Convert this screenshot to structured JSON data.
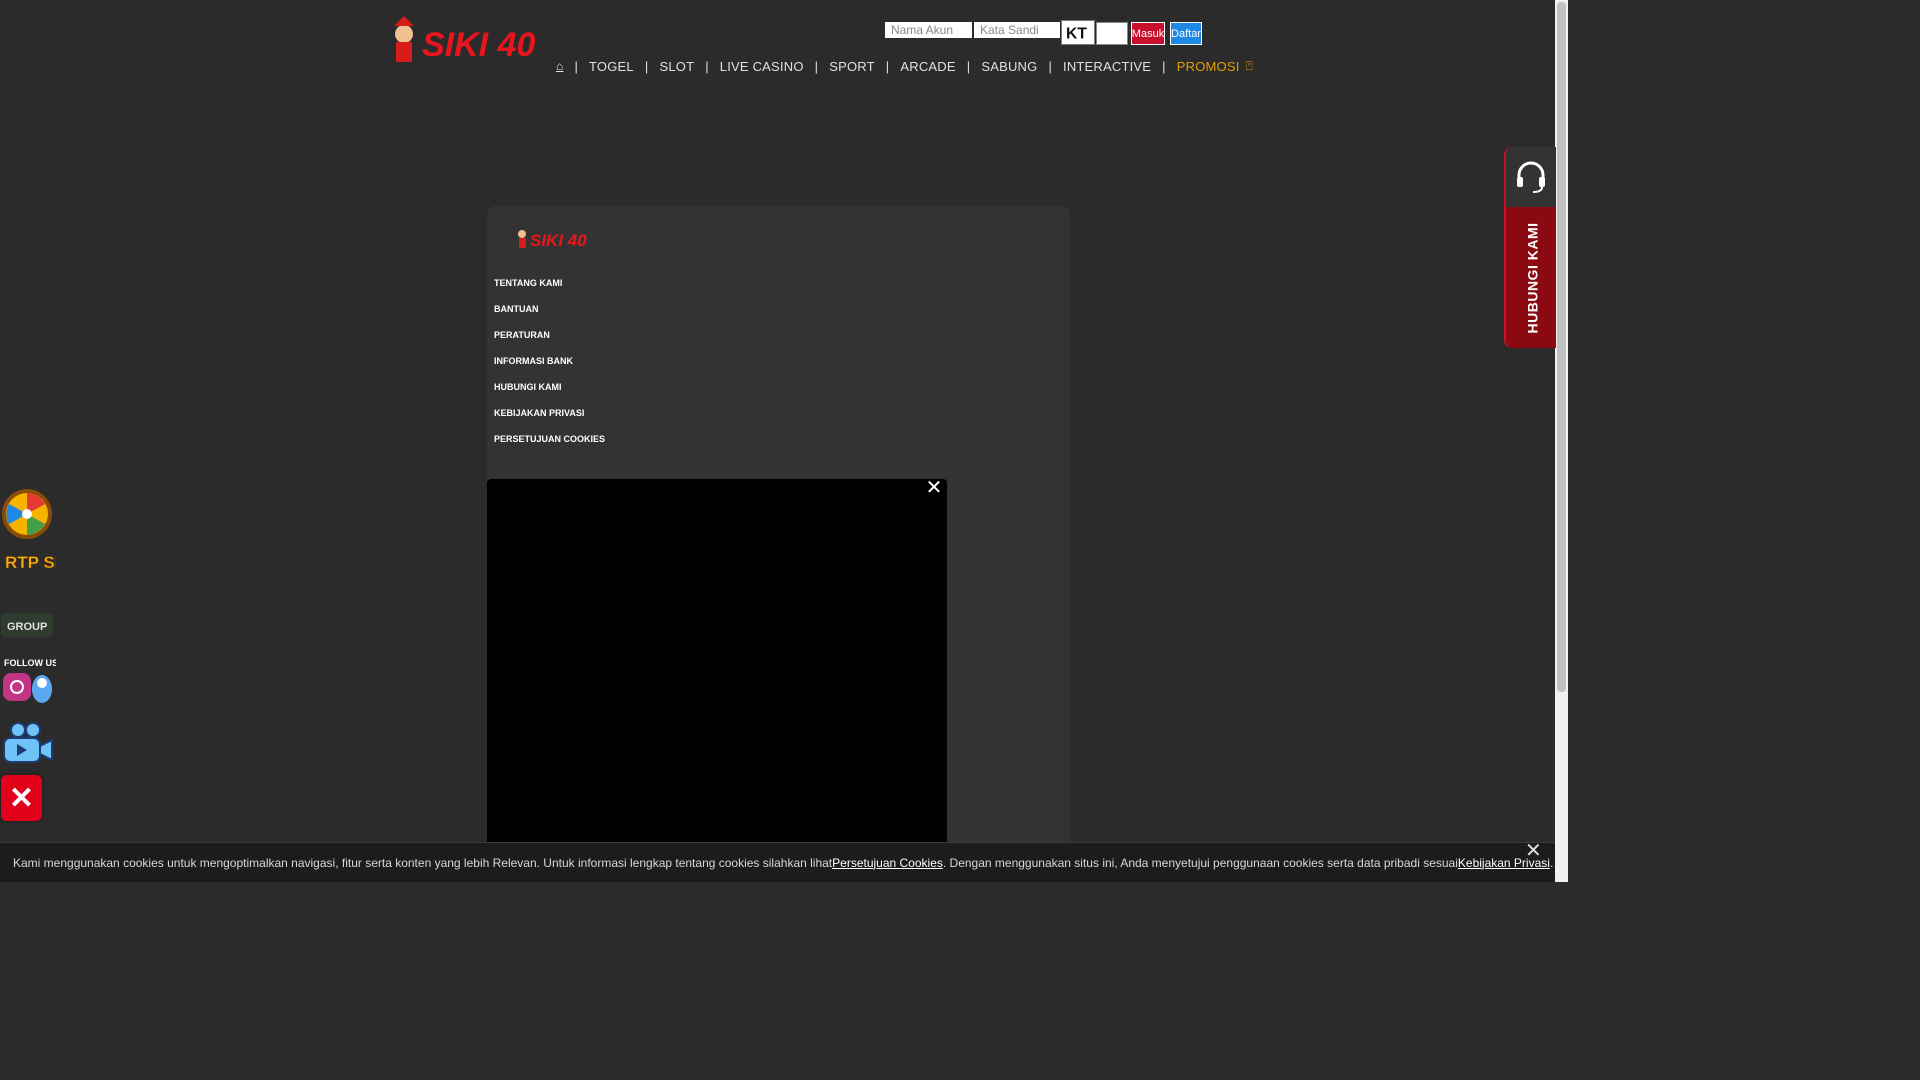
{
  "header": {
    "logo_alt": "SIKI 40",
    "login": {
      "username_placeholder": "Nama Akun",
      "password_placeholder": "Kata Sandi",
      "captcha_text": "KT",
      "login_label": "Masuk",
      "register_label": "Daftar"
    },
    "nav": [
      {
        "label": "TOGEL"
      },
      {
        "label": "SLOT"
      },
      {
        "label": "LIVE CASINO"
      },
      {
        "label": "SPORT"
      },
      {
        "label": "ARCADE"
      },
      {
        "label": "SABUNG"
      },
      {
        "label": "INTERACTIVE"
      },
      {
        "label": "PROMOSI"
      }
    ],
    "home_icon": "home-icon"
  },
  "footer": {
    "logo_alt": "SIKI 40",
    "links": [
      "TENTANG KAMI",
      "BANTUAN",
      "PERATURAN",
      "INFORMASI BANK",
      "HUBUNGI KAMI",
      "KEBIJAKAN PRIVASI",
      "PERSETUJUAN COOKIES"
    ]
  },
  "contact": {
    "label": "HUBUNGI KAMI",
    "icon": "headset-icon"
  },
  "floaters": {
    "rtp_text": "RTP SLOT",
    "group_text": "GROUP",
    "follow_text": "FOLLOW US"
  },
  "cookie": {
    "text_before": "Kami menggunakan cookies untuk mengoptimalkan navigasi, fitur serta konten yang lebih Relevan. Untuk informasi lengkap tentang cookies silahkan lihat ",
    "link1": "Persetujuan Cookies",
    "text_middle": ". Dengan menggunakan situs ini, Anda menyetujui penggunaan cookies serta data pribadi sesuai ",
    "link2": "Kebijakan Privasi",
    "text_after": "."
  },
  "colors": {
    "background": "#2b2b2b",
    "brand_red": "#c8102e",
    "register_blue": "#1e88e5",
    "promo_gold": "#e0a000"
  }
}
